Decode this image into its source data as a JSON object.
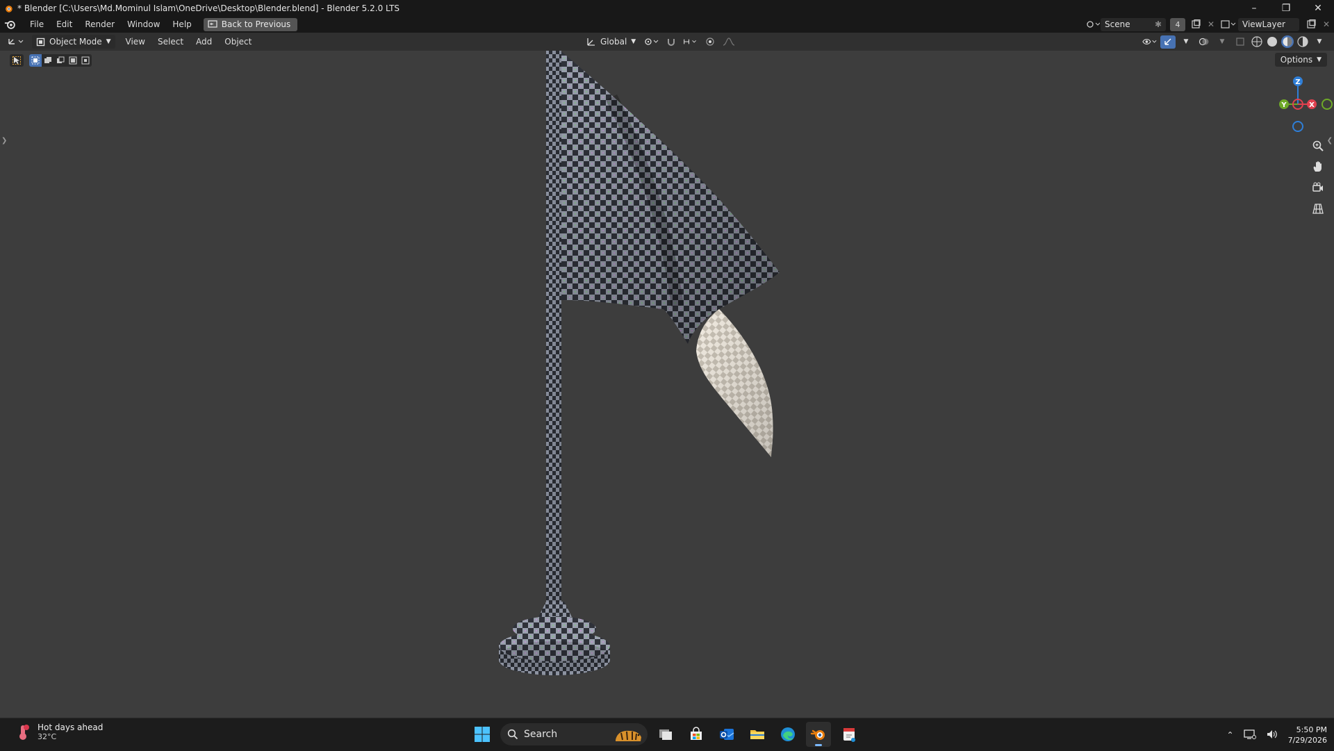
{
  "window": {
    "title": "* Blender [C:\\Users\\Md.Mominul Islam\\OneDrive\\Desktop\\Blender.blend] - Blender 5.2.0 LTS",
    "controls": [
      "minimize",
      "restore",
      "close"
    ]
  },
  "topbar": {
    "menus": [
      "File",
      "Edit",
      "Render",
      "Window",
      "Help"
    ],
    "back_button": "Back to Previous",
    "scene_label": "Scene",
    "scene_users": "4",
    "view_layer_label": "ViewLayer"
  },
  "viewport_header": {
    "mode": "Object Mode",
    "menus": [
      "View",
      "Select",
      "Add",
      "Object"
    ],
    "transform_orientation": "Global",
    "options_label": "Options"
  },
  "gizmo": {
    "axes": {
      "x": "X",
      "y": "Y",
      "z": "Z"
    },
    "colors": {
      "x": "#e0414f",
      "y": "#6ea928",
      "z": "#2f7fd8"
    }
  },
  "nav_tools": [
    "zoom-icon",
    "pan-hand-icon",
    "camera-view-icon",
    "ortho-grid-icon"
  ],
  "taskbar": {
    "weather_title": "Hot days ahead",
    "weather_temp": "32°C",
    "search_placeholder": "Search",
    "time": "5:50 PM",
    "date": "7/29/2026"
  },
  "colors": {
    "viewport_bg": "#3d3d3d",
    "header_bg": "#303030",
    "titlebar_bg": "#181818",
    "taskbar_bg": "#1c1c1c",
    "accent": "#4772b3"
  }
}
